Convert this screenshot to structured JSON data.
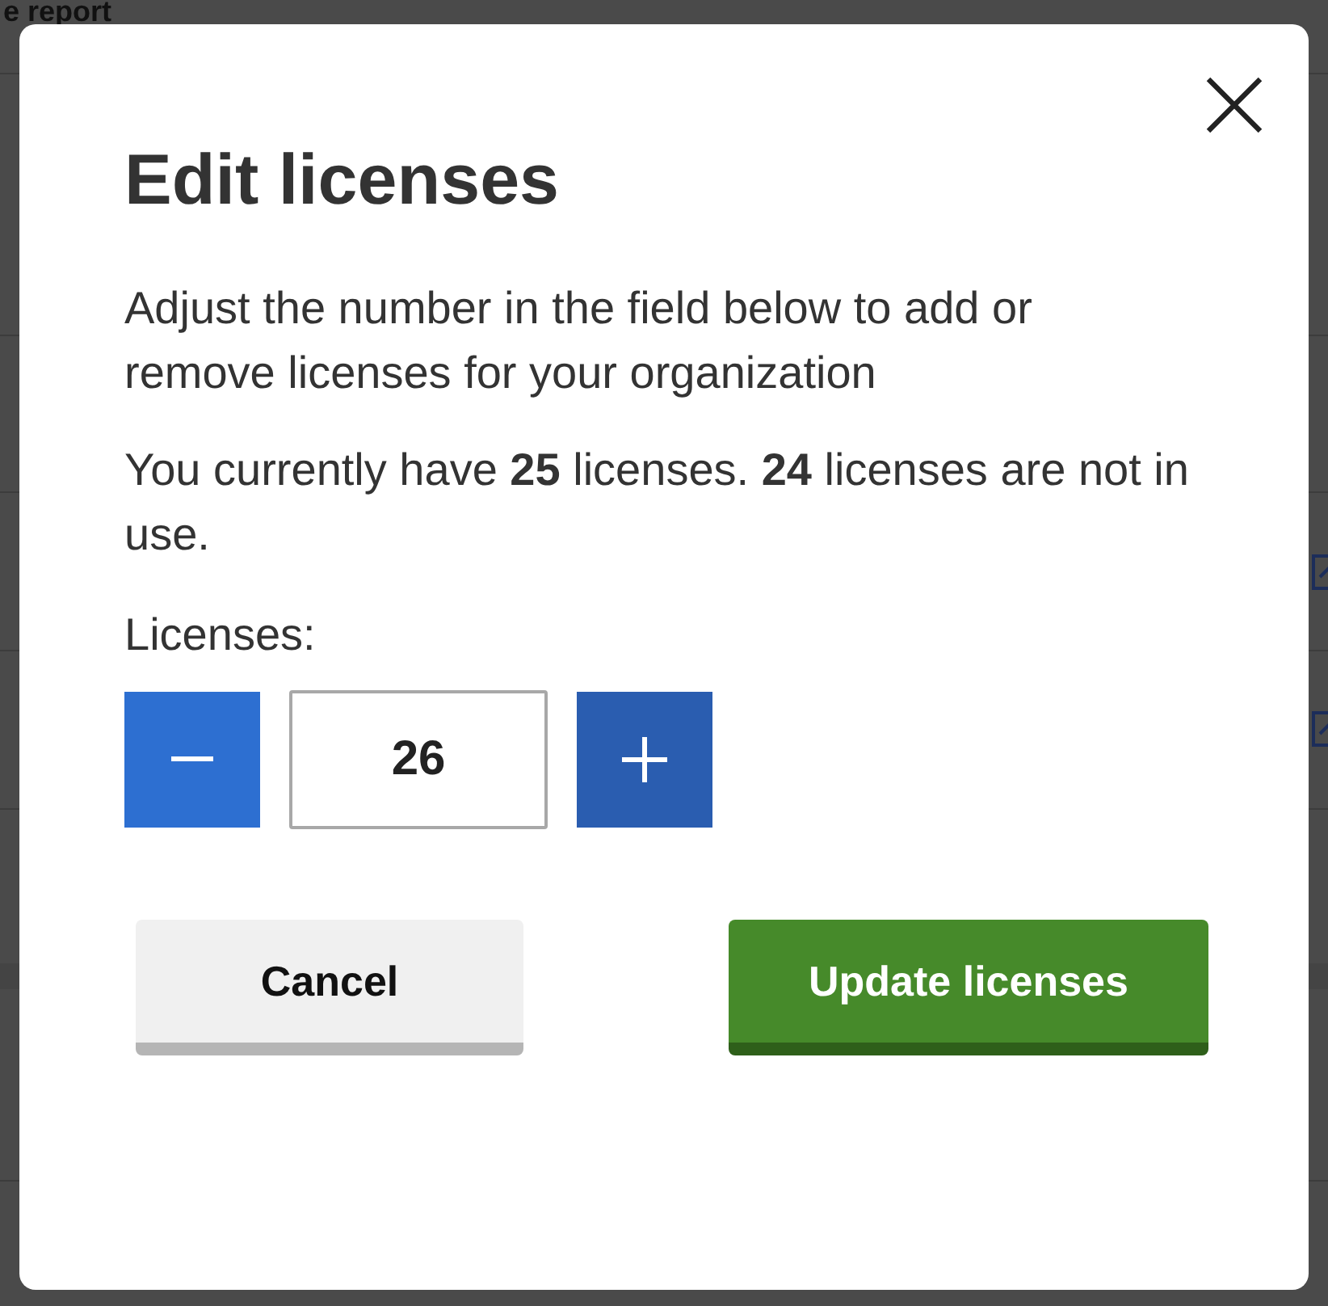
{
  "background": {
    "heading": "e report"
  },
  "dialog": {
    "title": "Edit licenses",
    "description": "Adjust the number in the field below to add or remove licenses for your organization",
    "status": "You currently have **25** licenses. **24** licenses are not in use.",
    "field_label": "Licenses:",
    "value": "26",
    "buttons": [
      {
        "label": "Cancel",
        "kind": "secondary"
      },
      {
        "label": "Update licenses",
        "kind": "primary"
      }
    ]
  }
}
